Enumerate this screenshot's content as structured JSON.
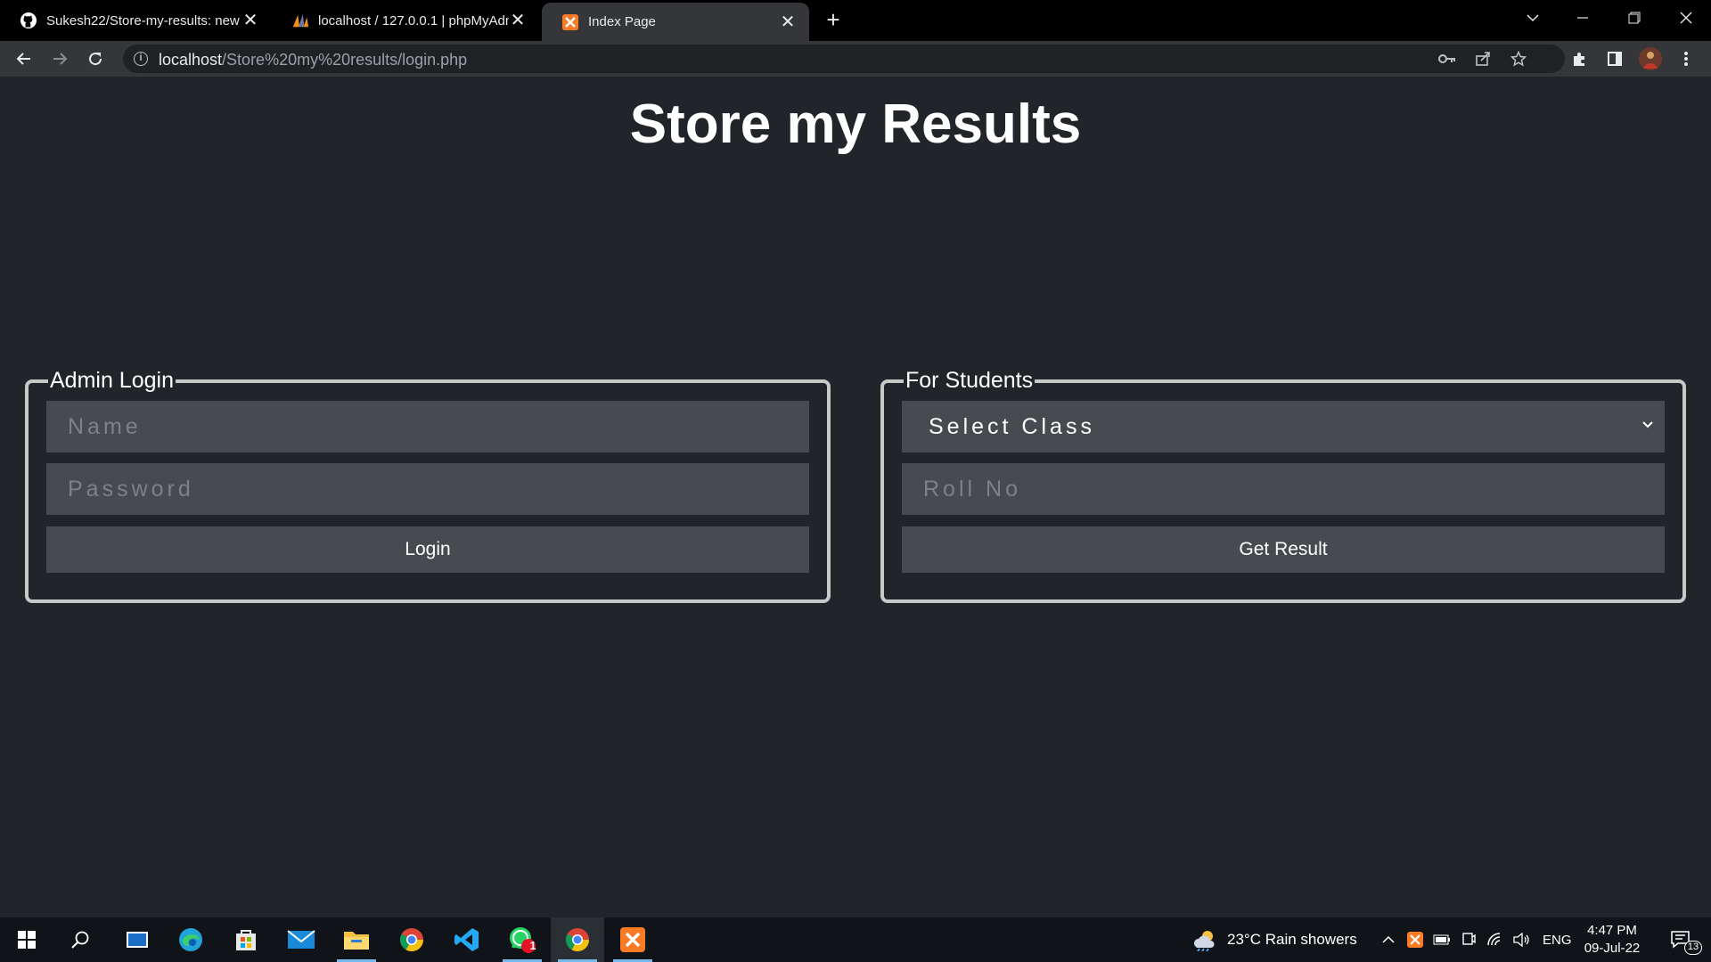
{
  "browser": {
    "tabs": [
      {
        "title": "Sukesh22/Store-my-results: new",
        "icon": "github-icon"
      },
      {
        "title": "localhost / 127.0.0.1 | phpMyAdm",
        "icon": "phpmyadmin-icon"
      },
      {
        "title": "Index Page",
        "icon": "xampp-icon",
        "active": true
      }
    ],
    "url_host": "localhost",
    "url_path": "/Store%20my%20results/login.php"
  },
  "page": {
    "title": "Store my Results",
    "admin": {
      "legend": "Admin Login",
      "name_placeholder": "Name",
      "password_placeholder": "Password",
      "login_label": "Login"
    },
    "students": {
      "legend": "For Students",
      "class_select": "Select Class",
      "roll_placeholder": "Roll No",
      "submit_label": "Get Result"
    }
  },
  "taskbar": {
    "weather": "23°C  Rain showers",
    "language": "ENG",
    "time": "4:47 PM",
    "date": "09-Jul-22",
    "notification_count": "13",
    "whatsapp_badge": "1"
  },
  "colors": {
    "page_bg": "#212529",
    "input_bg": "#474a4f",
    "panel_border": "#c8c8c8"
  }
}
